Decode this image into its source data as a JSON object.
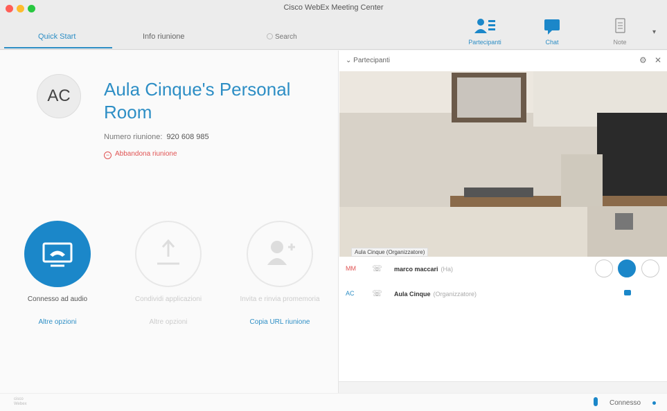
{
  "window": {
    "title": "Cisco WebEx Meeting Center"
  },
  "toolbar": {
    "tabs": [
      {
        "label": "Quick Start"
      },
      {
        "label": "Info riunione"
      }
    ],
    "search": {
      "placeholder": "Search"
    },
    "buttons": [
      {
        "label": "Partecipanti",
        "icon": "participants-icon"
      },
      {
        "label": "Chat",
        "icon": "chat-icon"
      },
      {
        "label": "Note",
        "icon": "notes-icon"
      }
    ],
    "more_icon": "▾"
  },
  "room": {
    "avatar_initials": "AC",
    "name": "Aula Cinque's Personal Room",
    "meeting_number_label": "Numero riunione:",
    "meeting_number": "920 608 985",
    "leave_label": "Abbandona riunione"
  },
  "actions": [
    {
      "label": "Connesso ad audio",
      "link": "Altre opzioni",
      "enabled": true
    },
    {
      "label": "Condividi applicazioni",
      "link": "Altre opzioni",
      "enabled": false
    },
    {
      "label": "Invita e rinvia promemoria",
      "link": "Copia URL riunione",
      "enabled": true
    }
  ],
  "participants_panel": {
    "title": "Partecipanti",
    "video_label": "Aula Cinque (Organizzatore)",
    "participants": [
      {
        "initials": "MM",
        "name": "marco maccari",
        "role": "(Ha)"
      },
      {
        "initials": "AC",
        "name": "Aula Cinque",
        "role": "(Organizzatore)"
      }
    ]
  },
  "status": {
    "brand_line1": "cisco",
    "brand_line2": "Webex",
    "connection": "Connesso"
  },
  "colors": {
    "accent": "#1b87c9",
    "link": "#2d8ec5",
    "danger": "#e05353"
  }
}
